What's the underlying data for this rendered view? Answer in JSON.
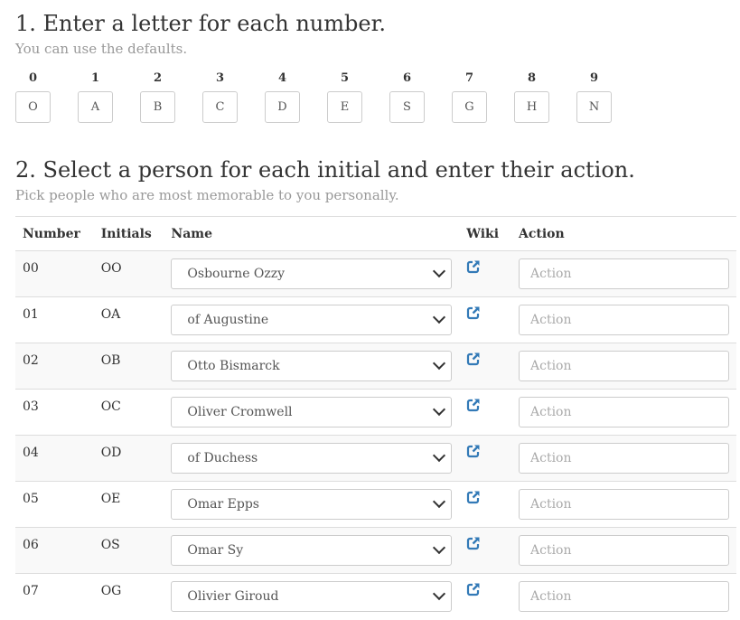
{
  "step1": {
    "title": "1. Enter a letter for each number.",
    "subtitle": "You can use the defaults.",
    "digits": [
      {
        "label": "0",
        "value": "O"
      },
      {
        "label": "1",
        "value": "A"
      },
      {
        "label": "2",
        "value": "B"
      },
      {
        "label": "3",
        "value": "C"
      },
      {
        "label": "4",
        "value": "D"
      },
      {
        "label": "5",
        "value": "E"
      },
      {
        "label": "6",
        "value": "S"
      },
      {
        "label": "7",
        "value": "G"
      },
      {
        "label": "8",
        "value": "H"
      },
      {
        "label": "9",
        "value": "N"
      }
    ]
  },
  "step2": {
    "title": "2. Select a person for each initial and enter their action.",
    "subtitle": "Pick people who are most memorable to you personally.",
    "columns": [
      "Number",
      "Initials",
      "Name",
      "Wiki",
      "Action"
    ],
    "rows": [
      {
        "number": "00",
        "initials": "OO",
        "name": "Osbourne Ozzy",
        "action_placeholder": "Action"
      },
      {
        "number": "01",
        "initials": "OA",
        "name": "of Augustine",
        "action_placeholder": "Action"
      },
      {
        "number": "02",
        "initials": "OB",
        "name": "Otto Bismarck",
        "action_placeholder": "Action"
      },
      {
        "number": "03",
        "initials": "OC",
        "name": "Oliver Cromwell",
        "action_placeholder": "Action"
      },
      {
        "number": "04",
        "initials": "OD",
        "name": "of Duchess",
        "action_placeholder": "Action"
      },
      {
        "number": "05",
        "initials": "OE",
        "name": "Omar Epps",
        "action_placeholder": "Action"
      },
      {
        "number": "06",
        "initials": "OS",
        "name": "Omar Sy",
        "action_placeholder": "Action"
      },
      {
        "number": "07",
        "initials": "OG",
        "name": "Olivier Giroud",
        "action_placeholder": "Action"
      }
    ]
  },
  "icons": {
    "wiki": "external-link-icon",
    "select": "chevron-down-icon"
  },
  "colors": {
    "link": "#337ab7",
    "muted": "#999999",
    "border": "#cccccc",
    "stripe": "#f9f9f9"
  }
}
